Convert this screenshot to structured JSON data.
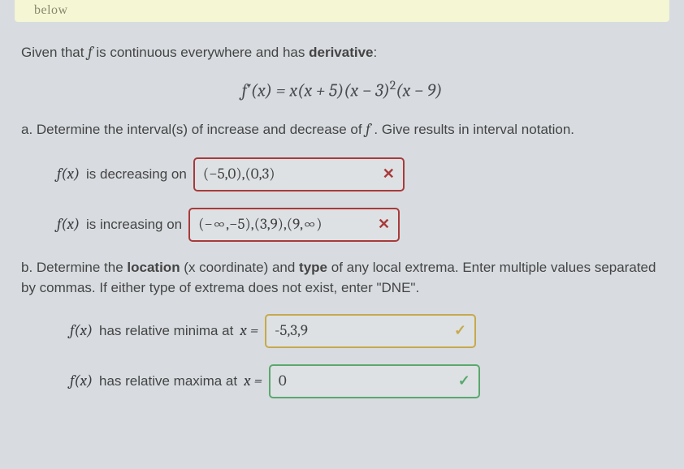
{
  "banner": {
    "word": "below"
  },
  "intro": {
    "prefix": "Given that ",
    "f": "f",
    "middle": " is continuous everywhere and has ",
    "boldword": "derivative",
    "suffix": ":"
  },
  "equation": {
    "lhs": "f′(x)",
    "eq": " = ",
    "rhs_a": "x(x + 5)(x − 3)",
    "rhs_exp": "2",
    "rhs_b": "(x − 9)"
  },
  "partA": {
    "label_a": "a. Determine the interval(s) of increase and decrease of ",
    "label_f": "f",
    "label_b": " . Give results in interval notation.",
    "dec_prefix": "f(x)",
    "dec_text": "  is decreasing on",
    "dec_answer": "(−5,0),(0,3)",
    "inc_prefix": "f(x)",
    "inc_text": "  is increasing on",
    "inc_answer": "(−∞,−5),(3,9),(9,∞)"
  },
  "partB": {
    "line1_a": "b. Determine the ",
    "line1_bold": "location",
    "line1_b": " (x coordinate) and ",
    "line1_bold2": "type",
    "line1_c": " of any local extrema. Enter multiple values separated by commas. If either type of extrema does not exist, enter \"DNE\".",
    "min_prefix": "f(x)",
    "min_text": " has relative minima at ",
    "min_var": "x =",
    "min_answer": "-5,3,9",
    "max_prefix": "f(x)",
    "max_text": " has relative maxima at ",
    "max_var": "x =",
    "max_answer": "0"
  },
  "marks": {
    "x": "✕",
    "check": "✓"
  }
}
